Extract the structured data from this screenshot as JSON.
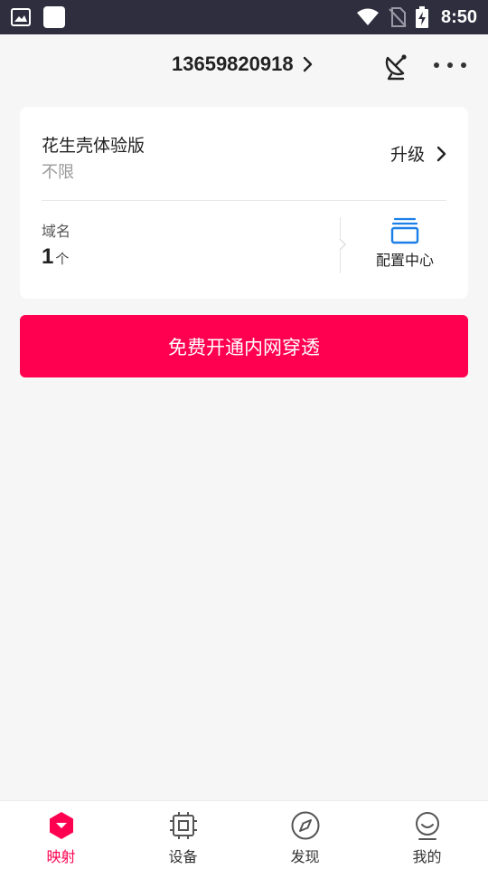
{
  "status_bar": {
    "time": "8:50",
    "icons": [
      "image-icon",
      "app-square-icon",
      "wifi-icon",
      "no-sim-icon",
      "battery-charging-icon"
    ]
  },
  "header": {
    "account": "13659820918",
    "icons": [
      "chevron-right-icon",
      "satellite-icon",
      "more-icon"
    ]
  },
  "plan_card": {
    "plan_name": "花生壳体验版",
    "plan_limit": "不限",
    "upgrade_label": "升级",
    "domain_label": "域名",
    "domain_count": "1",
    "domain_unit": "个",
    "config_label": "配置中心"
  },
  "cta": {
    "label": "免费开通内网穿透"
  },
  "tabbar": {
    "items": [
      {
        "label": "映射",
        "icon": "mapping-icon",
        "active": true
      },
      {
        "label": "设备",
        "icon": "device-icon",
        "active": false
      },
      {
        "label": "发现",
        "icon": "compass-icon",
        "active": false
      },
      {
        "label": "我的",
        "icon": "profile-icon",
        "active": false
      }
    ]
  },
  "colors": {
    "accent": "#ff0050",
    "status_bar_bg": "#2e2e3f",
    "config_icon": "#1a7fe8",
    "page_bg": "#f6f6f6"
  }
}
